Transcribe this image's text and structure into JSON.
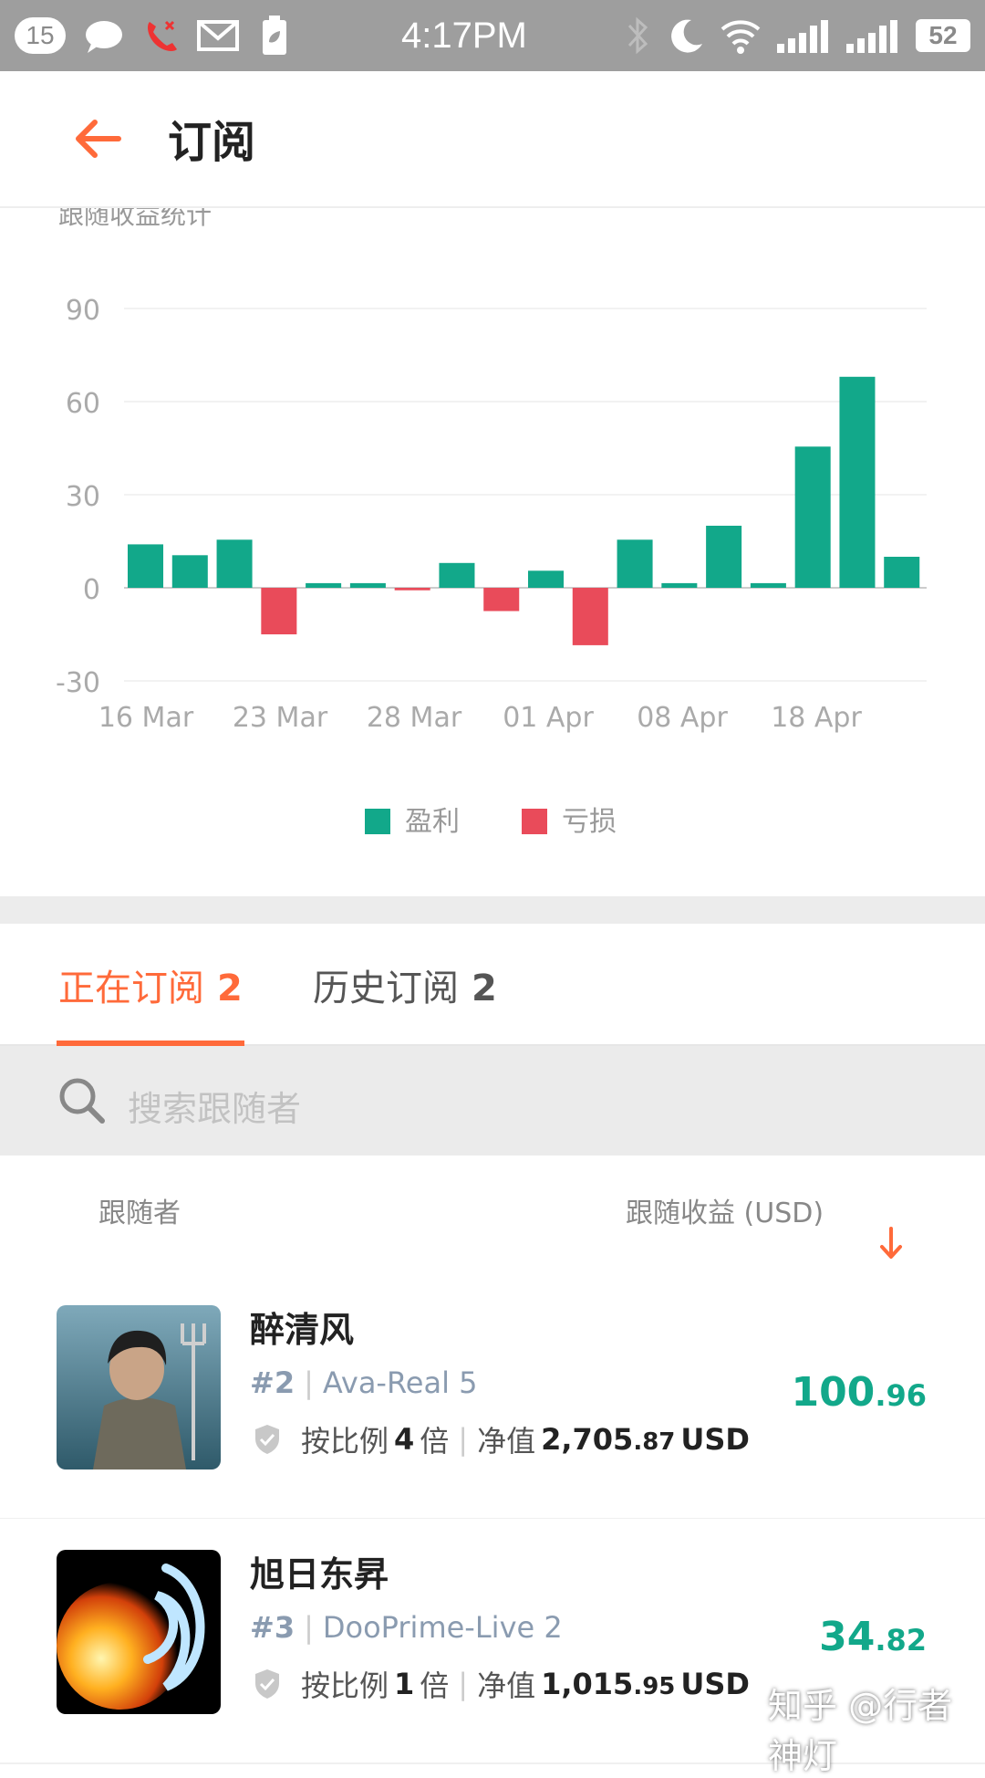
{
  "status_bar": {
    "notification_count": "15",
    "time": "4:17PM",
    "battery": "52"
  },
  "app_bar": {
    "title": "订阅"
  },
  "chart_section": {
    "subtitle": "跟随收益统计"
  },
  "chart_data": {
    "type": "bar",
    "yticks": [
      "90",
      "60",
      "30",
      "0",
      "-30"
    ],
    "ylim": [
      -30,
      90
    ],
    "xtick_labels": [
      "16 Mar",
      "23 Mar",
      "28 Mar",
      "01 Apr",
      "08 Apr",
      "18 Apr"
    ],
    "values": [
      14,
      10.5,
      15.5,
      -15,
      1.5,
      1.5,
      -0.8,
      8,
      -7.5,
      5.5,
      -18.5,
      15.5,
      1.5,
      20,
      1.5,
      45.5,
      68,
      10
    ],
    "series": [
      {
        "name": "盈利",
        "color": "#12a88a"
      },
      {
        "name": "亏损",
        "color": "#e94b5a"
      }
    ],
    "legend_position": "bottom",
    "grid": true
  },
  "tabs": [
    {
      "label": "正在订阅",
      "count": "2"
    },
    {
      "label": "历史订阅",
      "count": "2"
    }
  ],
  "search": {
    "placeholder": "搜索跟随者"
  },
  "list_header": {
    "follower": "跟随者",
    "profit": "跟随收益 (USD)"
  },
  "followers": [
    {
      "name": "醉清风",
      "rank": "#2",
      "account": "Ava-Real 5",
      "ratio_prefix": "按比例",
      "ratio": "4",
      "ratio_suffix": "倍",
      "equity_label": "净值",
      "equity_main": "2,705",
      "equity_dec": ".87",
      "equity_unit": "USD",
      "profit_main": "100",
      "profit_dec": ".96"
    },
    {
      "name": "旭日东昇",
      "rank": "#3",
      "account": "DooPrime-Live 2",
      "ratio_prefix": "按比例",
      "ratio": "1",
      "ratio_suffix": "倍",
      "equity_label": "净值",
      "equity_main": "1,015",
      "equity_dec": ".95",
      "equity_unit": "USD",
      "profit_main": "34",
      "profit_dec": ".82"
    }
  ],
  "watermark": "知乎 @行者神灯"
}
